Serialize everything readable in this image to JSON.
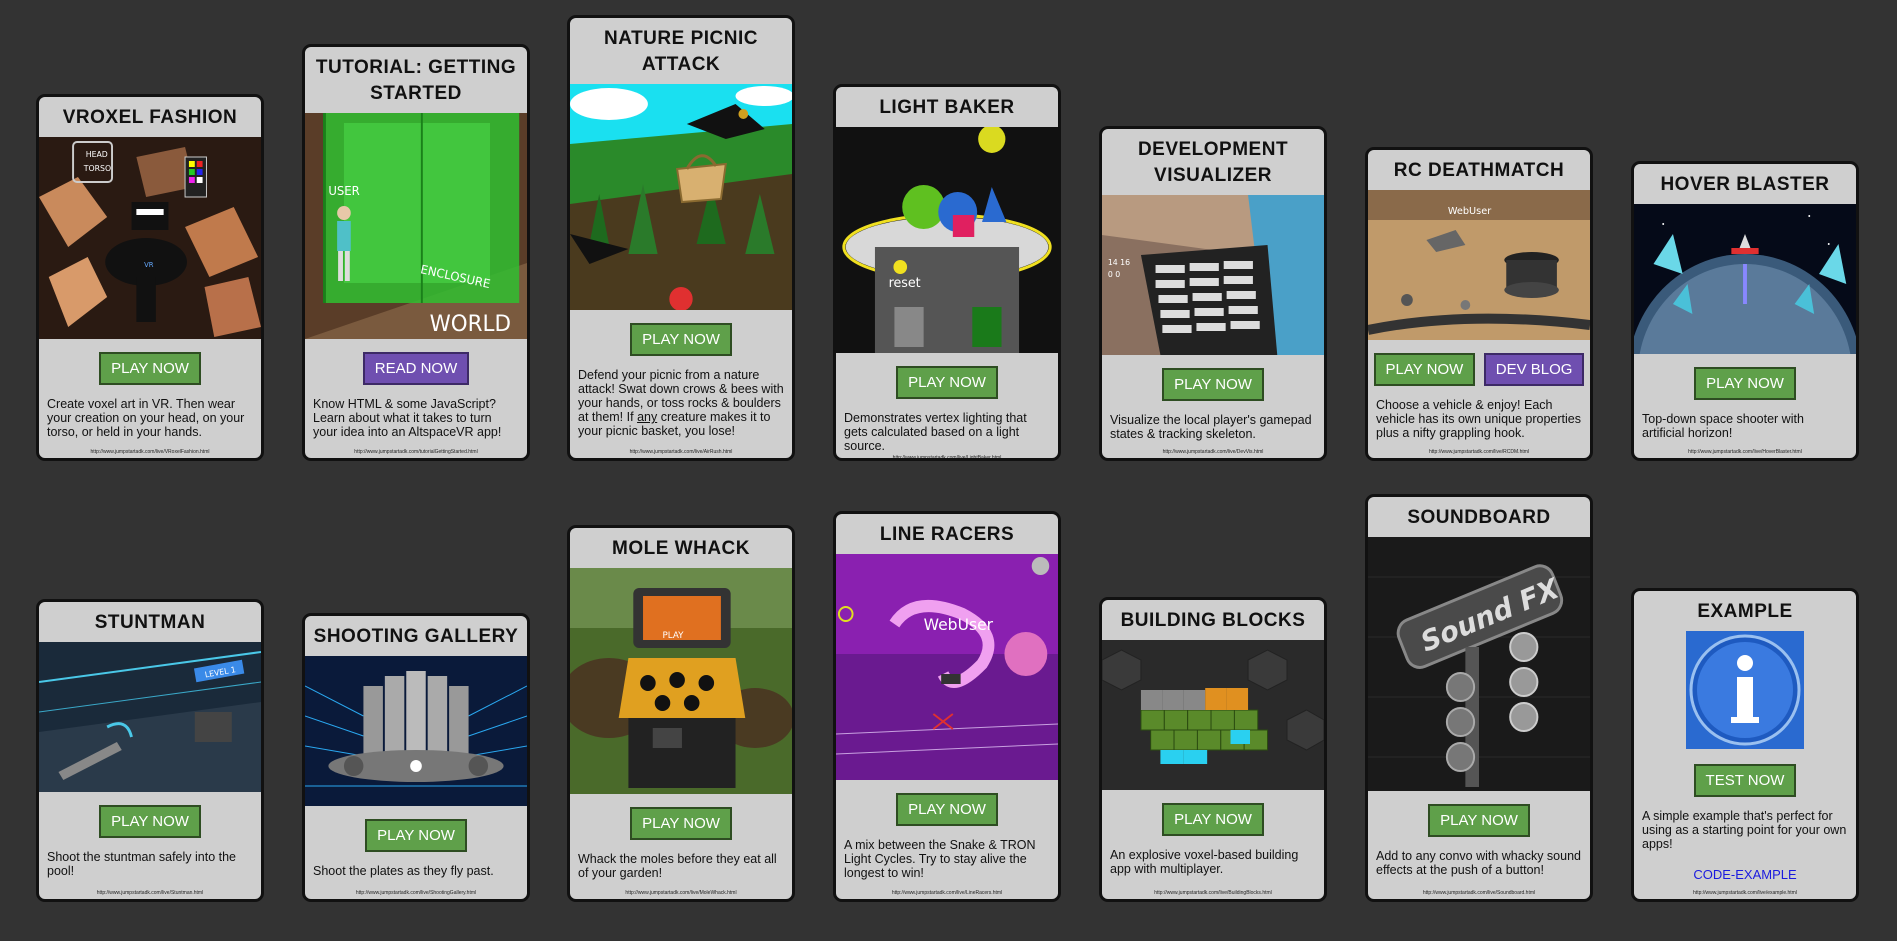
{
  "cards": [
    {
      "title": "VROXEL FASHION",
      "buttons": [
        "PLAY NOW"
      ],
      "desc": "Create voxel art in VR. Then wear your creation on your head, on your torso, or held in your hands.",
      "url": "http://www.jumpstartadk.com/live/VRoxelFashion.html",
      "img_text": [
        "HEAD",
        "TORSO"
      ]
    },
    {
      "title": "TUTORIAL: GETTING STARTED",
      "buttons": [
        "READ NOW"
      ],
      "desc": "Know HTML & some JavaScript? Learn about what it takes to turn your idea into an AltspaceVR app!",
      "url": "http://www.jumpstartadk.com/tutorialGettingStarted.html",
      "img_text": [
        "USER",
        "ENCLOSURE",
        "WORLD"
      ]
    },
    {
      "title": "NATURE PICNIC ATTACK",
      "buttons": [
        "PLAY NOW"
      ],
      "desc_parts": [
        "Defend your picnic from a nature attack! Swat down crows & bees with your hands, or toss rocks & boulders at them! If ",
        "any",
        " creature makes it to your picnic basket, you lose!"
      ],
      "url": "http://www.jumpstartadk.com/live/AirRush.html"
    },
    {
      "title": "LIGHT BAKER",
      "buttons": [
        "PLAY NOW"
      ],
      "desc": "Demonstrates vertex lighting that gets calculated based on a light source.",
      "url": "http://www.jumpstartadk.com/live/LightBaker.html",
      "img_text": [
        "reset"
      ]
    },
    {
      "title": "DEVELOPMENT VISUALIZER",
      "buttons": [
        "PLAY NOW"
      ],
      "desc": "Visualize the local player's gamepad states & tracking skeleton.",
      "url": "http://www.jumpstartadk.com/live/DevVis.html"
    },
    {
      "title": "RC DEATHMATCH",
      "buttons": [
        "PLAY NOW",
        "DEV BLOG"
      ],
      "desc": "Choose a vehicle & enjoy! Each vehicle has its own unique properties plus a nifty grappling hook.",
      "url": "http://www.jumpstartadk.com/live/RCDM.html",
      "img_text": [
        "WebUser"
      ]
    },
    {
      "title": "HOVER BLASTER",
      "buttons": [
        "PLAY NOW"
      ],
      "desc": "Top-down space shooter with artificial horizon!",
      "url": "http://www.jumpstartadk.com/live/HoverBlaster.html"
    },
    {
      "title": "STUNTMAN",
      "buttons": [
        "PLAY NOW"
      ],
      "desc": "Shoot the stuntman safely into the pool!",
      "url": "http://www.jumpstartadk.com/live/Stuntman.html",
      "img_text": [
        "LEVEL 1"
      ]
    },
    {
      "title": "SHOOTING GALLERY",
      "buttons": [
        "PLAY NOW"
      ],
      "desc": "Shoot the plates as they fly past.",
      "url": "http://www.jumpstartadk.com/live/ShootingGallery.html"
    },
    {
      "title": "MOLE WHACK",
      "buttons": [
        "PLAY NOW"
      ],
      "desc": "Whack the moles before they eat all of your garden!",
      "url": "http://www.jumpstartadk.com/live/MoleWhack.html"
    },
    {
      "title": "LINE RACERS",
      "buttons": [
        "PLAY NOW"
      ],
      "desc": "A mix between the Snake & TRON Light Cycles. Try to stay alive the longest to win!",
      "url": "http://www.jumpstartadk.com/live/LineRacers.html",
      "img_text": [
        "WebUser"
      ]
    },
    {
      "title": "BUILDING BLOCKS",
      "buttons": [
        "PLAY NOW"
      ],
      "desc": "An explosive voxel-based building app with multiplayer.",
      "url": "http://www.jumpstartadk.com/live/BuildingBlocks.html"
    },
    {
      "title": "SOUNDBOARD",
      "buttons": [
        "PLAY NOW"
      ],
      "desc": "Add to any convo with whacky sound effects at the push of a button!",
      "url": "http://www.jumpstartadk.com/live/Soundboard.html",
      "img_text": [
        "Sound FX"
      ]
    },
    {
      "title": "EXAMPLE",
      "buttons": [
        "TEST NOW"
      ],
      "desc": "A simple example that's perfect for using as a starting point for your own apps!",
      "link": "CODE-EXAMPLE",
      "url": "http://www.jumpstartadk.com/live/example.html"
    }
  ],
  "colors": {
    "background": "#333333",
    "card": "#cfcfcf",
    "play_button": "#5fa04a",
    "blog_button": "#6f4fb0",
    "link": "#1a1adf"
  }
}
